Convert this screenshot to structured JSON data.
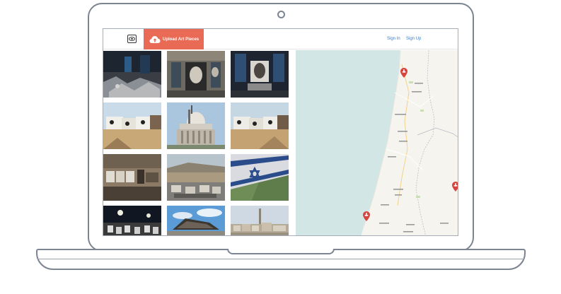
{
  "app": {
    "logo_icon": "eye-icon",
    "upload_button": {
      "label": "Upload Art Pieces",
      "icon": "cloud-upload-icon",
      "color": "#e96a55"
    },
    "nav": {
      "sign_in": "Sign In",
      "sign_up": "Sign Up",
      "link_color": "#3a7bc8"
    }
  },
  "gallery": {
    "tiles": [
      {
        "subject": "ruined interior with debris"
      },
      {
        "subject": "mural portrait in doorway"
      },
      {
        "subject": "dark hall with portrait"
      },
      {
        "subject": "cars with eyes in desert"
      },
      {
        "subject": "domed building under scaffolding"
      },
      {
        "subject": "cars with eyes in desert"
      },
      {
        "subject": "portraits on old stone wall"
      },
      {
        "subject": "village square with portraits"
      },
      {
        "subject": "flag with portrait"
      },
      {
        "subject": "night crowd with portraits"
      },
      {
        "subject": "boat shaped sculpture"
      },
      {
        "subject": "city skyline with minaret"
      }
    ]
  },
  "map": {
    "pins": [
      {
        "name": "north-pin"
      },
      {
        "name": "east-pin"
      },
      {
        "name": "coast-pin"
      }
    ],
    "colors": {
      "sea": "#d3e6e6",
      "land": "#f5f4ef",
      "pin": "#d6443f"
    }
  }
}
